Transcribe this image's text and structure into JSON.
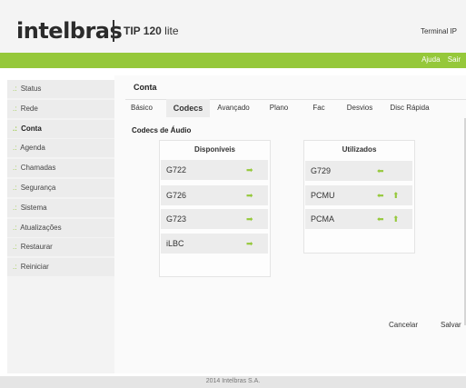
{
  "header": {
    "logo": "intelbras",
    "model_bold": "TIP 120",
    "model_rest": " lite",
    "terminal": "Terminal IP"
  },
  "topnav": {
    "help": "Ajuda",
    "exit": "Sair"
  },
  "sidebar": {
    "bullet": ".:",
    "items": [
      {
        "label": "Status"
      },
      {
        "label": "Rede"
      },
      {
        "label": "Conta"
      },
      {
        "label": "Agenda"
      },
      {
        "label": "Chamadas"
      },
      {
        "label": "Segurança"
      },
      {
        "label": "Sistema"
      },
      {
        "label": "Atualizações"
      },
      {
        "label": "Restaurar"
      },
      {
        "label": "Reiniciar"
      }
    ],
    "active": "Conta"
  },
  "main": {
    "title": "Conta",
    "tabs": [
      {
        "label": "Básico"
      },
      {
        "label": "Codecs"
      },
      {
        "label": "Avançado"
      },
      {
        "label": "Plano"
      },
      {
        "label": "Fac"
      },
      {
        "label": "Desvios"
      },
      {
        "label": "Disc Rápida"
      }
    ],
    "active_tab": "Codecs",
    "codecs_label": "Codecs de Áudio",
    "available": {
      "title": "Disponíveis",
      "items": [
        {
          "label": "G722"
        },
        {
          "label": "G726"
        },
        {
          "label": "G723"
        },
        {
          "label": "iLBC"
        }
      ]
    },
    "used": {
      "title": "Utilizados",
      "items": [
        {
          "label": "G729"
        },
        {
          "label": "PCMU"
        },
        {
          "label": "PCMA"
        }
      ]
    },
    "cancel_label": "Cancelar",
    "save_label": "Salvar"
  },
  "icons": {
    "move_right": "➡",
    "move_left": "⬅",
    "move_up": "⬆"
  },
  "colors": {
    "accent": "#95c83a"
  },
  "footer": {
    "copyright": "2014 Intelbras S.A."
  }
}
